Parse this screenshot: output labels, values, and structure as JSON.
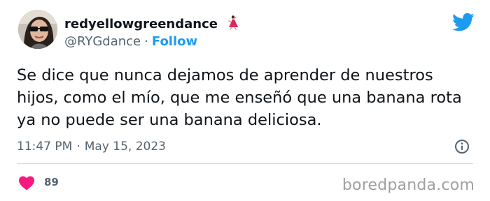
{
  "author": {
    "display_name": "redyellowgreendance",
    "emoji_icon": "dancer-icon",
    "handle": "@RYGdance",
    "separator": "·",
    "follow_label": "Follow"
  },
  "tweet": {
    "lines": [
      "Se dice que nunca dejamos de aprender de nuestros",
      "hijos, como el mío, que me enseñó que una banana rota",
      "ya no puede ser una banana deliciosa."
    ],
    "time": "11:47 PM",
    "separator": "·",
    "date": "May 15, 2023"
  },
  "engagement": {
    "like_count": "89",
    "like_icon": "heart-icon"
  },
  "watermark": "boredpanda.com",
  "colors": {
    "accent": "#1d9bf0",
    "heart": "#f91880",
    "muted_text": "#536471",
    "primary_text": "#0f1419"
  }
}
